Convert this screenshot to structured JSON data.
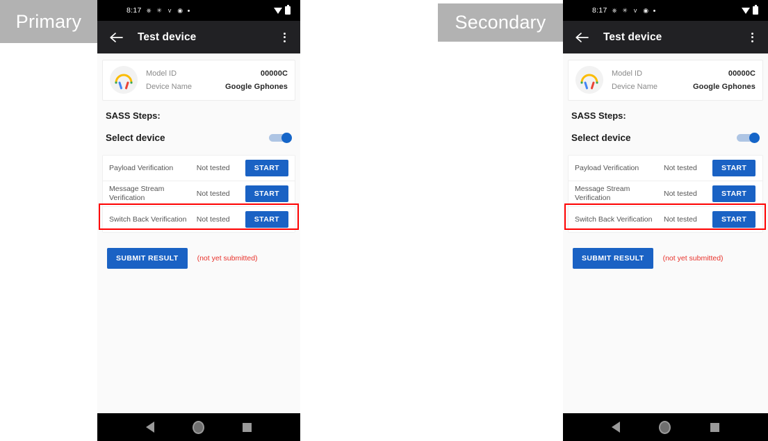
{
  "annotations": {
    "primary_label": "Primary",
    "secondary_label": "Secondary",
    "highlight_color": "#fe0000"
  },
  "status_bar": {
    "clock": "8:17",
    "icons": [
      "sync-icon",
      "brightness-icon",
      "bluetooth-icon",
      "settings-icon",
      "dot-icon"
    ],
    "right_icons": [
      "wifi-icon",
      "battery-icon"
    ]
  },
  "app_bar": {
    "back_icon": "back-arrow-icon",
    "title": "Test device",
    "overflow_icon": "overflow-menu-icon"
  },
  "device_card": {
    "icon": "headphones-icon",
    "rows": [
      {
        "label": "Model ID",
        "value": "00000C"
      },
      {
        "label": "Device Name",
        "value": "Google Gphones"
      }
    ]
  },
  "steps": {
    "section_title": "SASS Steps:",
    "select_device_label": "Select device",
    "toggle_state": "on",
    "tests": [
      {
        "name": "Payload Verification",
        "status": "Not tested",
        "action": "START"
      },
      {
        "name": "Message Stream Verification",
        "status": "Not tested",
        "action": "START"
      },
      {
        "name": "Switch Back Verification",
        "status": "Not tested",
        "action": "START"
      }
    ]
  },
  "submit": {
    "button_label": "SUBMIT RESULT",
    "note": "(not yet submitted)",
    "note_color": "#e8322b"
  },
  "nav_bar": {
    "back": "nav-back-icon",
    "home": "nav-home-icon",
    "recents": "nav-recents-icon"
  },
  "theme": {
    "accent_blue": "#1a62c4",
    "app_bar_bg": "#212124",
    "page_bg": "#fafafa"
  }
}
